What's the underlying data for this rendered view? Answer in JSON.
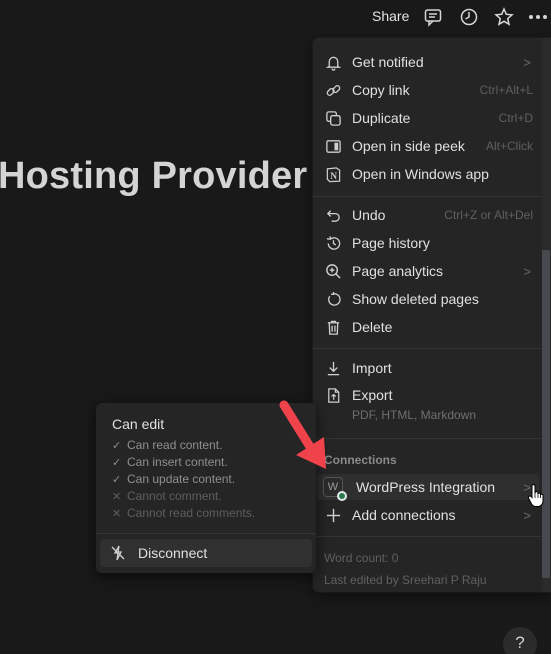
{
  "topbar": {
    "share_label": "Share",
    "icons": [
      "comment-icon",
      "clock-icon",
      "star-icon",
      "more-icon"
    ]
  },
  "page": {
    "title": "Hosting Provider"
  },
  "menu": {
    "items": [
      {
        "label": "Get notified",
        "icon": "bell-icon",
        "shortcut": "",
        "has_submenu": true
      },
      {
        "label": "Copy link",
        "icon": "link-icon",
        "shortcut": "Ctrl+Alt+L",
        "has_submenu": false
      },
      {
        "label": "Duplicate",
        "icon": "duplicate-icon",
        "shortcut": "Ctrl+D",
        "has_submenu": false
      },
      {
        "label": "Open in side peek",
        "icon": "side-peek-icon",
        "shortcut": "Alt+Click",
        "has_submenu": false
      },
      {
        "label": "Open in Windows app",
        "icon": "notion-app-icon",
        "shortcut": "",
        "has_submenu": false
      },
      {
        "label": "Undo",
        "icon": "undo-icon",
        "shortcut": "Ctrl+Z or Alt+Del",
        "has_submenu": false
      },
      {
        "label": "Page history",
        "icon": "history-icon",
        "shortcut": "",
        "has_submenu": false
      },
      {
        "label": "Page analytics",
        "icon": "analytics-icon",
        "shortcut": "",
        "has_submenu": true
      },
      {
        "label": "Show deleted pages",
        "icon": "restore-icon",
        "shortcut": "",
        "has_submenu": false
      },
      {
        "label": "Delete",
        "icon": "trash-icon",
        "shortcut": "",
        "has_submenu": false
      },
      {
        "label": "Import",
        "icon": "import-icon",
        "shortcut": "",
        "has_submenu": false
      },
      {
        "label": "Export",
        "icon": "export-icon",
        "shortcut": "",
        "has_submenu": false,
        "subtitle": "PDF, HTML, Markdown"
      }
    ],
    "connections_header": "Connections",
    "connections": [
      {
        "label": "WordPress Integration",
        "icon_letter": "W",
        "status_color": "#2b7a4b",
        "has_submenu": true
      },
      {
        "label": "Add connections",
        "icon": "plus-icon",
        "has_submenu": true
      }
    ],
    "footer": {
      "word_count": "Word count: 0",
      "last_edited": "Last edited by Sreehari P Raju"
    }
  },
  "submenu": {
    "title": "Can edit",
    "permissions": [
      {
        "text": "Can read content.",
        "allowed": true
      },
      {
        "text": "Can insert content.",
        "allowed": true
      },
      {
        "text": "Can update content.",
        "allowed": true
      },
      {
        "text": "Cannot comment.",
        "allowed": false
      },
      {
        "text": "Cannot read comments.",
        "allowed": false
      }
    ],
    "disconnect_label": "Disconnect"
  },
  "help": {
    "label": "?"
  },
  "colors": {
    "background": "#191919",
    "menu": "#252525",
    "arrow": "#f0424a",
    "connected": "#2b7a4b"
  }
}
